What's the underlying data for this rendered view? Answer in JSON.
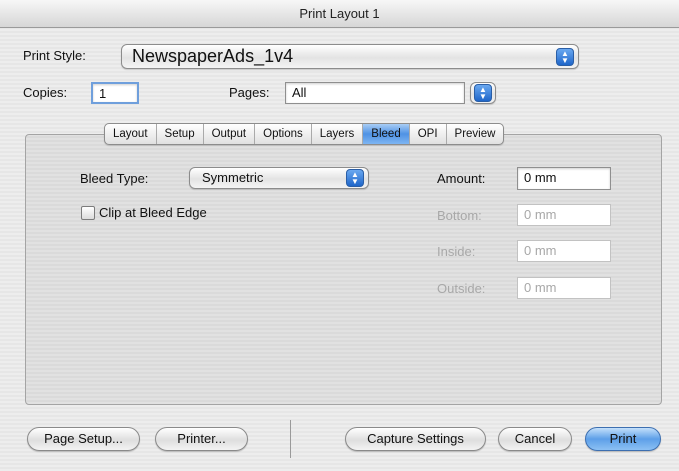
{
  "window": {
    "title": "Print Layout 1"
  },
  "print_style": {
    "label": "Print Style:",
    "value": "NewspaperAds_1v4"
  },
  "copies": {
    "label": "Copies:",
    "value": "1"
  },
  "pages": {
    "label": "Pages:",
    "value": "All"
  },
  "tabs": [
    "Layout",
    "Setup",
    "Output",
    "Options",
    "Layers",
    "Bleed",
    "OPI",
    "Preview"
  ],
  "active_tab": "Bleed",
  "bleed": {
    "type_label": "Bleed Type:",
    "type_value": "Symmetric",
    "clip_label": "Clip at Bleed Edge",
    "clip_checked": false,
    "amount_label": "Amount:",
    "amount_value": "0 mm",
    "bottom_label": "Bottom:",
    "bottom_value": "0 mm",
    "inside_label": "Inside:",
    "inside_value": "0 mm",
    "outside_label": "Outside:",
    "outside_value": "0 mm"
  },
  "buttons": {
    "page_setup": "Page Setup...",
    "printer": "Printer...",
    "capture": "Capture Settings",
    "cancel": "Cancel",
    "print": "Print"
  },
  "icons": {
    "stepper": "popup-arrows-icon"
  },
  "colors": {
    "accent": "#4f92e4",
    "disabled_text": "#a8a8a8"
  }
}
